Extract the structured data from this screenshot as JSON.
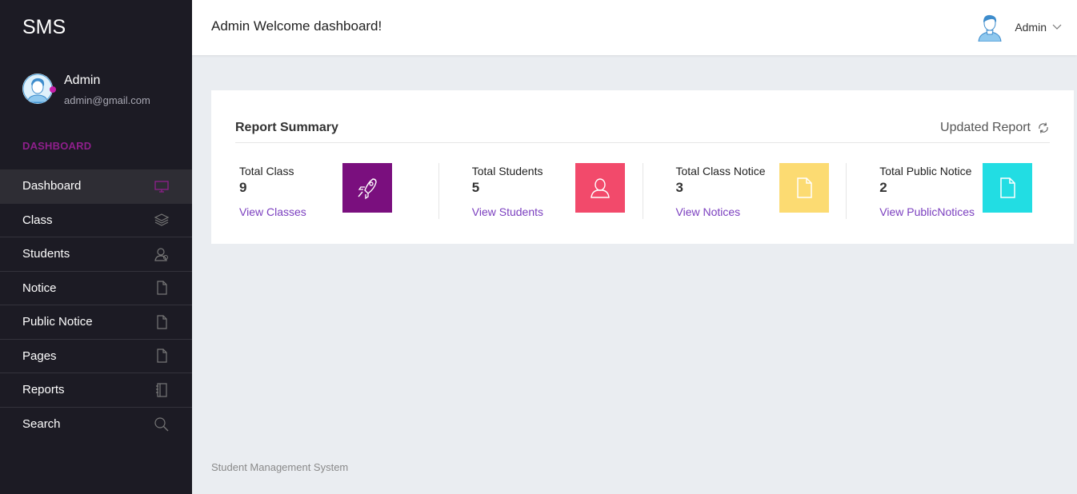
{
  "sidebar": {
    "brand": "SMS",
    "profile": {
      "name": "Admin",
      "email": "admin@gmail.com"
    },
    "section_label": "DASHBOARD",
    "items": [
      {
        "label": "Dashboard",
        "icon": "monitor-icon"
      },
      {
        "label": "Class",
        "icon": "layers-icon"
      },
      {
        "label": "Students",
        "icon": "user-icon"
      },
      {
        "label": "Notice",
        "icon": "file-icon"
      },
      {
        "label": "Public Notice",
        "icon": "file-icon"
      },
      {
        "label": "Pages",
        "icon": "file-icon"
      },
      {
        "label": "Reports",
        "icon": "notebook-icon"
      },
      {
        "label": "Search",
        "icon": "search-icon"
      }
    ]
  },
  "header": {
    "title": "Admin Welcome dashboard!",
    "user_name": "Admin"
  },
  "report": {
    "title": "Report Summary",
    "action": "Updated Report",
    "stats": [
      {
        "label": "Total Class",
        "value": "9",
        "link": "View Classes",
        "color": "#7a0f7e",
        "icon": "rocket-icon"
      },
      {
        "label": "Total Students",
        "value": "5",
        "link": "View Students",
        "color": "#f24a6b",
        "icon": "user-icon"
      },
      {
        "label": "Total Class Notice",
        "value": "3",
        "link": "View Notices",
        "color": "#fcdb72",
        "icon": "file-icon"
      },
      {
        "label": "Total Public Notice",
        "value": "2",
        "link": "View PublicNotices",
        "color": "#22dde3",
        "icon": "file-icon"
      }
    ]
  },
  "footer": {
    "text": "Student Management System"
  },
  "colors": {
    "sidebar_bg": "#1c1b24",
    "accent": "#8f1f8c",
    "link": "#7b3fbf",
    "page_bg": "#eaedf1"
  }
}
